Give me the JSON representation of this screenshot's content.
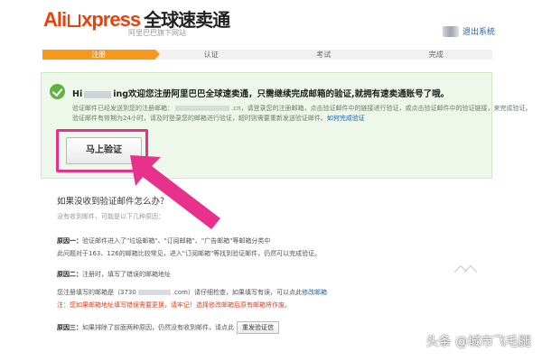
{
  "header": {
    "logo_prefix": "Ali",
    "logo_suffix": "xpress",
    "logo_cn": "全球速卖通",
    "tagline": "阿里巴巴旗下网站",
    "logout_label": "退出系统"
  },
  "steps": [
    {
      "label": "注册",
      "active": true
    },
    {
      "label": "认证",
      "active": false
    },
    {
      "label": "考试",
      "active": false
    },
    {
      "label": "完成",
      "active": false
    }
  ],
  "success_panel": {
    "title_start": "Hi",
    "title_name": "ing",
    "title_rest": "欢迎您注册阿里巴巴全球速卖通，只需继续完成邮箱的验证,就拥有速卖通账号了哦。",
    "line1_start": "验证邮件已经发送到您的注册邮箱：",
    "line1_email_tail": ".cn",
    "line1_rest": "，请登录您的注册邮箱，点击验证邮件中的链接进行验证，或点击验证邮件中的验证链接，来完成验证。",
    "line2": "验证邮件有效期为24小时，请及时登录您的邮箱进行验证，超时则需要重新发送验证邮件。",
    "line2_link": "如何完成验证",
    "verify_button": "马上验证",
    "icon": "check-circle-icon"
  },
  "help": {
    "title": "如果没收到验证邮件怎么办？",
    "subtitle": "没有收到邮件，可能是以下几种原因：",
    "q1_label": "原因一：",
    "q1_text": "验证邮件进入了\"垃圾邮箱\"、\"订阅邮箱\"、\"广告邮箱\"等邮箱分类中",
    "q1_note": "此问题对于163、126的邮箱比较常见，进入\"订阅邮箱\"等找到验证邮件，仍然可以完成验证。",
    "q2_label": "原因二：",
    "q2_text": "注册时，填写了错误的邮箱地址",
    "q2_note_start": "您注册填写的邮箱是（3730",
    "q2_note_mid": ".com）请仔细检查，如果填写有误，可以点此",
    "q2_link": "修改邮箱",
    "q2_warn": "注：您如果邮箱地址填写错误需要更换，请牢记！选择修改邮箱后原有邮箱将作废。",
    "q3_label": "原因三：",
    "q3_text": "如果排除了前面两种原因，仍然没有收到邮件，请点此",
    "resend_button": "重发验证信"
  },
  "watermark": "头条 @城市飞毛腿",
  "colors": {
    "brand": "#e8410b",
    "step_active": "#f7981d",
    "panel_bg": "#eef8ea",
    "success_green": "#60b43d",
    "annotation_pink": "#e8318a",
    "link": "#1b5fb5"
  }
}
